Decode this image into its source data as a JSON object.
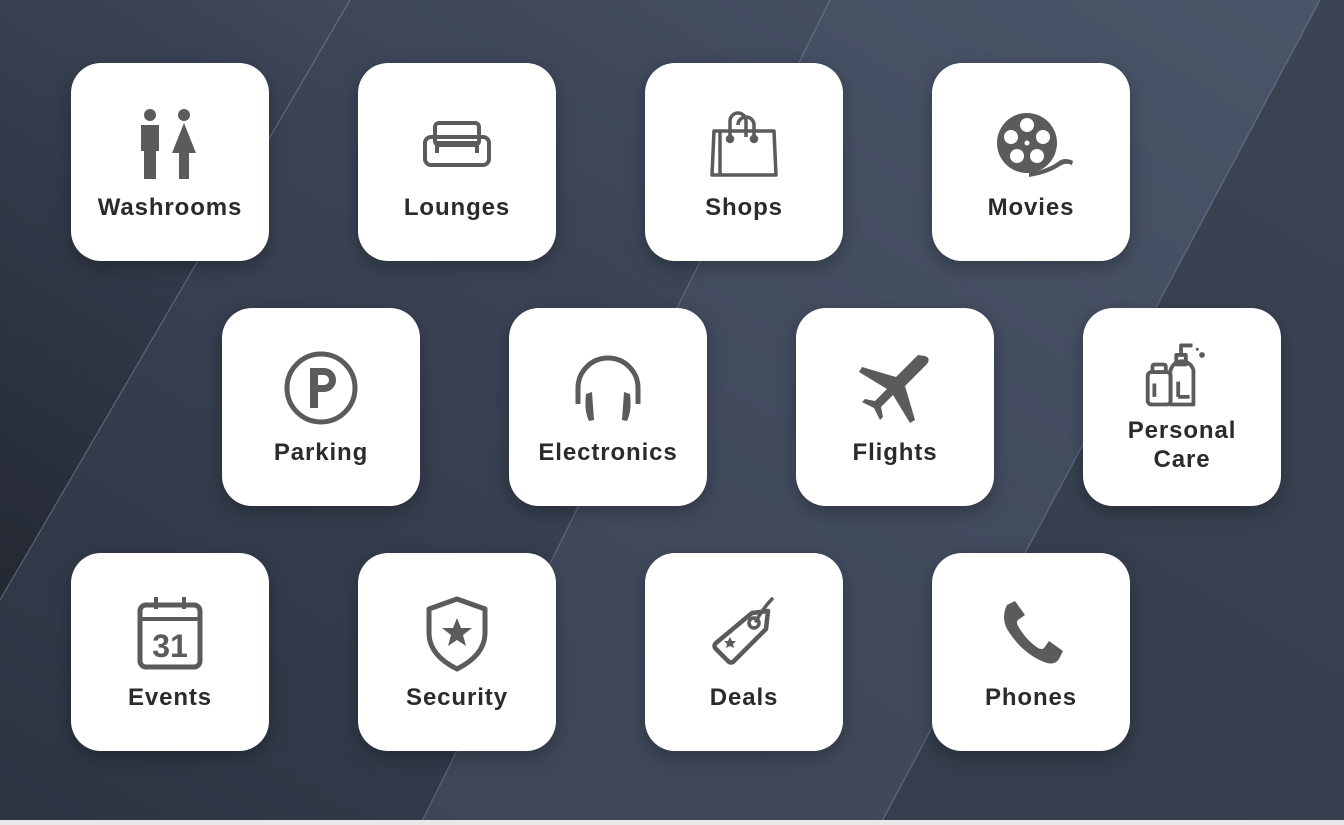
{
  "colors": {
    "tile_background": "#ffffff",
    "icon": "#5b5b5b",
    "label": "#2b2b2b",
    "background_dark": "#1f232c",
    "background_light": "#5f6b80"
  },
  "tiles": [
    {
      "label": "Washrooms",
      "icon": "washroom-icon"
    },
    {
      "label": "Lounges",
      "icon": "sofa-icon"
    },
    {
      "label": "Shops",
      "icon": "shopping-bag-icon"
    },
    {
      "label": "Movies",
      "icon": "film-reel-icon"
    },
    {
      "label": "Parking",
      "icon": "parking-icon"
    },
    {
      "label": "Electronics",
      "icon": "headphones-icon"
    },
    {
      "label": "Flights",
      "icon": "airplane-icon"
    },
    {
      "label": "Personal\nCare",
      "icon": "soap-bottles-icon"
    },
    {
      "label": "Events",
      "icon": "calendar-icon",
      "icon_text": "31"
    },
    {
      "label": "Security",
      "icon": "shield-star-icon"
    },
    {
      "label": "Deals",
      "icon": "price-tag-icon"
    },
    {
      "label": "Phones",
      "icon": "phone-icon"
    }
  ]
}
